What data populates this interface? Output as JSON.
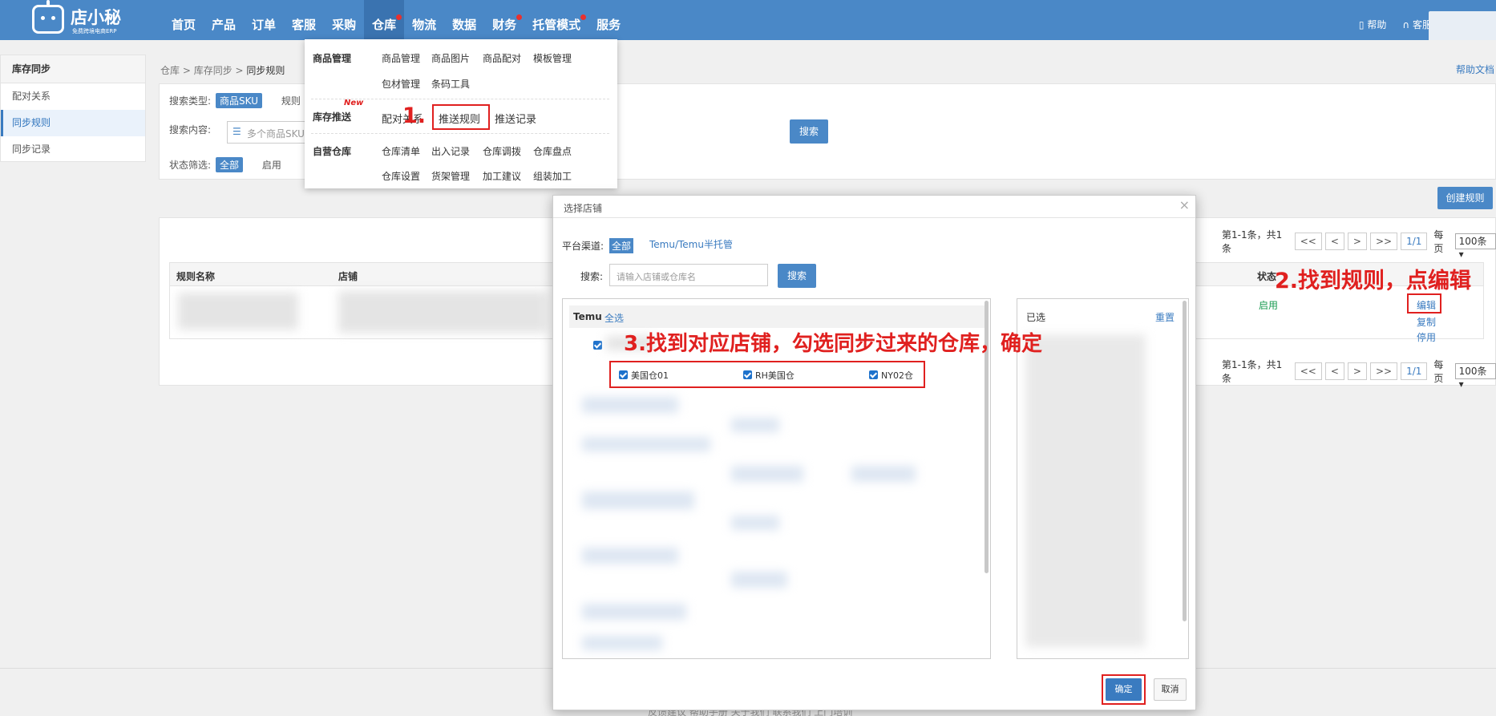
{
  "logo": {
    "name": "店小秘",
    "sub": "免费跨境电商ERP"
  },
  "nav": [
    {
      "label": "首页",
      "dot": false
    },
    {
      "label": "产品",
      "dot": false
    },
    {
      "label": "订单",
      "dot": false
    },
    {
      "label": "客服",
      "dot": false
    },
    {
      "label": "采购",
      "dot": false
    },
    {
      "label": "仓库",
      "dot": true,
      "active": true
    },
    {
      "label": "物流",
      "dot": false
    },
    {
      "label": "数据",
      "dot": false
    },
    {
      "label": "财务",
      "dot": true
    },
    {
      "label": "托管模式",
      "dot": true
    },
    {
      "label": "服务",
      "dot": false
    }
  ],
  "topRight": {
    "help": "帮助",
    "service": "客服"
  },
  "sidebar": {
    "title": "库存同步",
    "items": [
      {
        "label": "配对关系"
      },
      {
        "label": "同步规则"
      },
      {
        "label": "同步记录"
      }
    ]
  },
  "breadcrumb": {
    "a": "仓库",
    "b": "库存同步",
    "c": "同步规则"
  },
  "helpDoc": "帮助文档",
  "filter": {
    "typeLabel": "搜索类型:",
    "typeActive": "商品SKU",
    "typeOther": "规则",
    "contentLabel": "搜索内容:",
    "contentPlaceholder": "多个商品SKU",
    "searchBtn": "搜索",
    "statusLabel": "状态筛选:",
    "statusAll": "全部",
    "statusOn": "启用"
  },
  "createBtn": "创建规则",
  "pager": {
    "info": "第1-1条，共1条",
    "first": "<<",
    "prev": "<",
    "next": ">",
    "last": ">>",
    "current": "1/1",
    "perPageLabel": "每页",
    "perPage": "100条"
  },
  "table": {
    "colName": "规则名称",
    "colShop": "店铺",
    "colStatus": "状态",
    "row": {
      "status": "启用",
      "edit": "编辑",
      "copy": "复制",
      "disable": "停用"
    }
  },
  "dropdown": {
    "sections": [
      {
        "title": "商品管理",
        "items": [
          "商品管理",
          "商品图片",
          "商品配对",
          "模板管理",
          "包材管理",
          "条码工具"
        ]
      },
      {
        "title": "库存推送",
        "badge": "New",
        "items": [
          "配对关系",
          "推送规则",
          "推送记录"
        ]
      },
      {
        "title": "自营仓库",
        "items": [
          "仓库清单",
          "出入记录",
          "仓库调拨",
          "仓库盘点",
          "仓库设置",
          "货架管理",
          "加工建议",
          "组装加工"
        ]
      }
    ]
  },
  "annotations": {
    "step1": "1.",
    "step2": "2.找到规则，点编辑",
    "step3": "3.找到对应店铺，勾选同步过来的仓库，确定"
  },
  "modal": {
    "title": "选择店铺",
    "close": "×",
    "platformLabel": "平台渠道:",
    "platformAll": "全部",
    "platformTemu": "Temu/Temu半托管",
    "searchLabel": "搜索:",
    "searchPlaceholder": "请输入店铺或仓库名",
    "searchBtn": "搜索",
    "leftHead": "Temu",
    "selectAll": "全选",
    "warehouses": [
      "美国仓01",
      "RH美国仓",
      "NY02仓"
    ],
    "selectedLabel": "已选",
    "reset": "重置",
    "ok": "确定",
    "cancel": "取消"
  },
  "footer": "反馈建议  帮助手册  关于我们  联系我们  上门培训",
  "colors": {
    "primary": "#4a88c7",
    "annotation": "#e0201f",
    "status": "#1a9b52"
  }
}
